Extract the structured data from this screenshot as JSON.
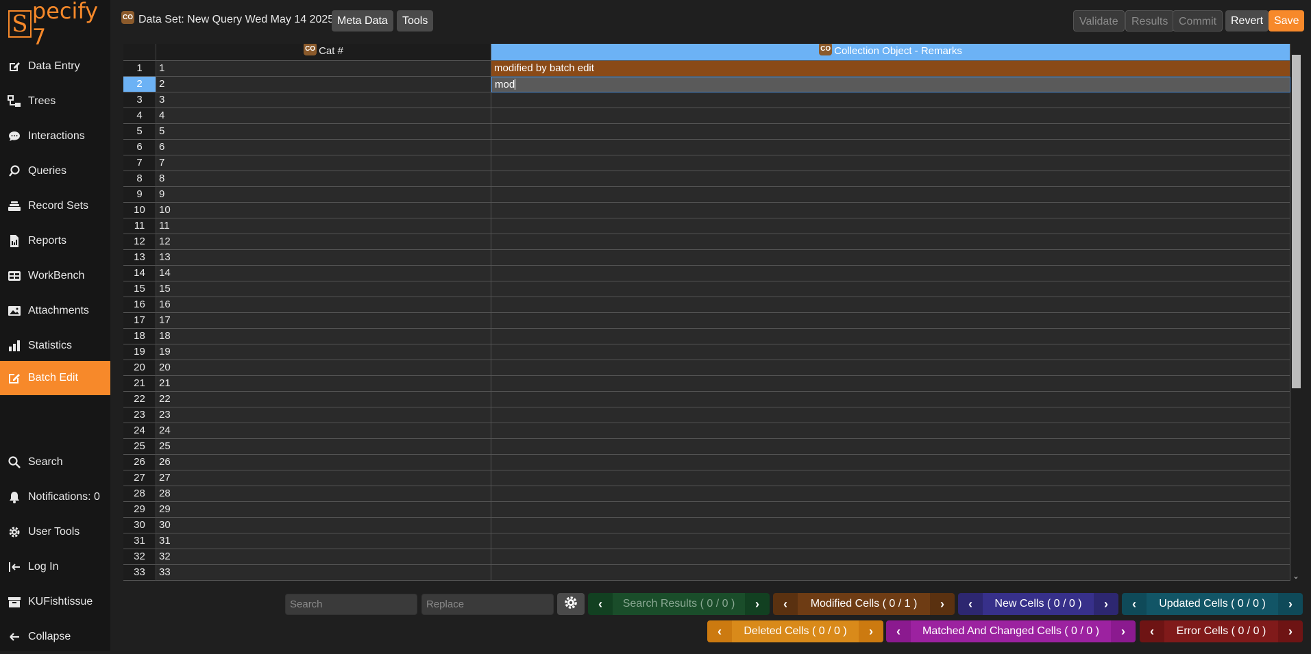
{
  "app": {
    "logo_letter": "S",
    "logo_rest": "pecify 7"
  },
  "sidebar": {
    "items": [
      {
        "label": "Data Entry",
        "icon": "edit-icon"
      },
      {
        "label": "Trees",
        "icon": "tree-icon"
      },
      {
        "label": "Interactions",
        "icon": "chat-icon"
      },
      {
        "label": "Queries",
        "icon": "query-icon"
      },
      {
        "label": "Record Sets",
        "icon": "stack-icon"
      },
      {
        "label": "Reports",
        "icon": "report-icon"
      },
      {
        "label": "WorkBench",
        "icon": "table-icon"
      },
      {
        "label": "Attachments",
        "icon": "image-icon"
      },
      {
        "label": "Statistics",
        "icon": "chart-icon"
      },
      {
        "label": "Batch Edit",
        "icon": "batch-edit-icon"
      }
    ],
    "bottom_items": [
      {
        "label": "Search",
        "icon": "search-icon"
      },
      {
        "label": "Notifications: 0",
        "icon": "bell-icon"
      },
      {
        "label": "User Tools",
        "icon": "gear-icon"
      },
      {
        "label": "Log In",
        "icon": "login-icon"
      },
      {
        "label": "KUFishtissue",
        "icon": "collection-icon"
      },
      {
        "label": "Collapse",
        "icon": "arrow-left-icon"
      }
    ]
  },
  "header": {
    "badge": "CO",
    "title": "Data Set: New Query Wed May 14 2025",
    "meta_label": "Meta Data",
    "tools_label": "Tools",
    "validate_label": "Validate",
    "results_label": "Results",
    "commit_label": "Commit",
    "revert_label": "Revert",
    "save_label": "Save"
  },
  "grid": {
    "columns": [
      {
        "badge": "CO",
        "label": "Cat #"
      },
      {
        "badge": "CO",
        "label": "Collection Object - Remarks"
      }
    ],
    "rows": [
      {
        "n": "1",
        "cat": "1",
        "remarks": "modified by batch edit",
        "modified": true
      },
      {
        "n": "2",
        "cat": "2",
        "remarks": "mod",
        "editing": true
      },
      {
        "n": "3",
        "cat": "3",
        "remarks": ""
      },
      {
        "n": "4",
        "cat": "4",
        "remarks": ""
      },
      {
        "n": "5",
        "cat": "5",
        "remarks": ""
      },
      {
        "n": "6",
        "cat": "6",
        "remarks": ""
      },
      {
        "n": "7",
        "cat": "7",
        "remarks": ""
      },
      {
        "n": "8",
        "cat": "8",
        "remarks": ""
      },
      {
        "n": "9",
        "cat": "9",
        "remarks": ""
      },
      {
        "n": "10",
        "cat": "10",
        "remarks": ""
      },
      {
        "n": "11",
        "cat": "11",
        "remarks": ""
      },
      {
        "n": "12",
        "cat": "12",
        "remarks": ""
      },
      {
        "n": "13",
        "cat": "13",
        "remarks": ""
      },
      {
        "n": "14",
        "cat": "14",
        "remarks": ""
      },
      {
        "n": "15",
        "cat": "15",
        "remarks": ""
      },
      {
        "n": "16",
        "cat": "16",
        "remarks": ""
      },
      {
        "n": "17",
        "cat": "17",
        "remarks": ""
      },
      {
        "n": "18",
        "cat": "18",
        "remarks": ""
      },
      {
        "n": "19",
        "cat": "19",
        "remarks": ""
      },
      {
        "n": "20",
        "cat": "20",
        "remarks": ""
      },
      {
        "n": "21",
        "cat": "21",
        "remarks": ""
      },
      {
        "n": "22",
        "cat": "22",
        "remarks": ""
      },
      {
        "n": "23",
        "cat": "23",
        "remarks": ""
      },
      {
        "n": "24",
        "cat": "24",
        "remarks": ""
      },
      {
        "n": "25",
        "cat": "25",
        "remarks": ""
      },
      {
        "n": "26",
        "cat": "26",
        "remarks": ""
      },
      {
        "n": "27",
        "cat": "27",
        "remarks": ""
      },
      {
        "n": "28",
        "cat": "28",
        "remarks": ""
      },
      {
        "n": "29",
        "cat": "29",
        "remarks": ""
      },
      {
        "n": "30",
        "cat": "30",
        "remarks": ""
      },
      {
        "n": "31",
        "cat": "31",
        "remarks": ""
      },
      {
        "n": "32",
        "cat": "32",
        "remarks": ""
      },
      {
        "n": "33",
        "cat": "33",
        "remarks": ""
      }
    ]
  },
  "toolbar": {
    "search_placeholder": "Search",
    "replace_placeholder": "Replace",
    "pills": [
      {
        "key": "search",
        "label": "Search Results ( 0 / 0 )"
      },
      {
        "key": "mod",
        "label": "Modified Cells ( 0 / 1 )"
      },
      {
        "key": "new",
        "label": "New Cells ( 0 / 0 )"
      },
      {
        "key": "upd",
        "label": "Updated Cells ( 0 / 0 )"
      },
      {
        "key": "del",
        "label": "Deleted Cells ( 0 / 0 )"
      },
      {
        "key": "match",
        "label": "Matched And Changed Cells ( 0 / 0 )"
      },
      {
        "key": "err",
        "label": "Error Cells ( 0 / 0 )"
      }
    ]
  }
}
